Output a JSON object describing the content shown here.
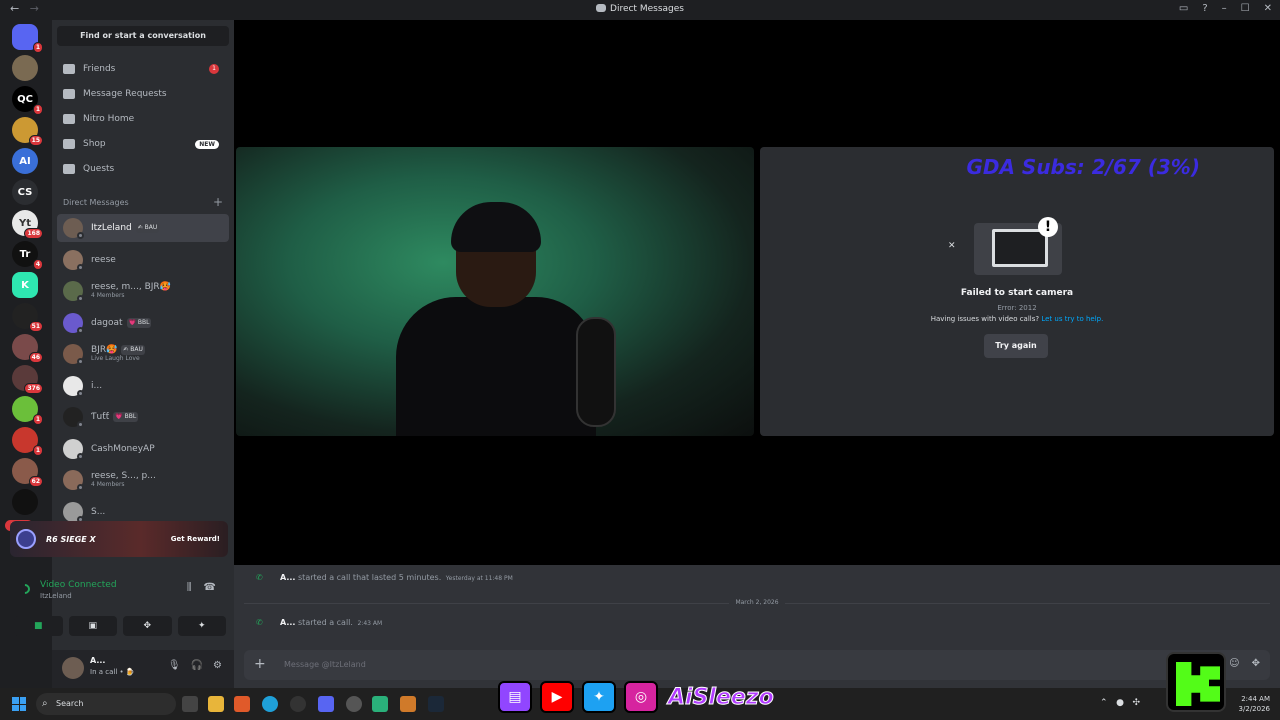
{
  "titlebar": {
    "title": "Direct Messages",
    "back": "←",
    "forward": "→",
    "win_icons": [
      "▭",
      "?",
      "–",
      "☐",
      "✕"
    ]
  },
  "guilds": {
    "items": [
      {
        "name": "discord-home",
        "label": "",
        "badge": "1",
        "color": "#5865f2"
      },
      {
        "name": "server-avatar-1",
        "label": "",
        "badge": "",
        "color": "#7a6a52"
      },
      {
        "name": "server-qc",
        "label": "QC",
        "badge": "1",
        "color": "#000000"
      },
      {
        "name": "server-4",
        "label": "",
        "badge": "15",
        "color": "#c93"
      },
      {
        "name": "server-ai",
        "label": "AI",
        "badge": "",
        "color": "#3a6fd8"
      },
      {
        "name": "server-cs",
        "label": "CS",
        "badge": "",
        "color": "#2b2d31"
      },
      {
        "name": "server-yt",
        "label": "Yt",
        "badge": "168",
        "color": "#e8e8e8"
      },
      {
        "name": "server-tr",
        "label": "Tr",
        "badge": "4",
        "color": "#111"
      },
      {
        "name": "server-kick",
        "label": "K",
        "badge": "",
        "color": "#2ee6b0"
      },
      {
        "name": "server-10",
        "label": "",
        "badge": "51",
        "color": "#222"
      },
      {
        "name": "server-11",
        "label": "",
        "badge": "46",
        "color": "#7a4a4a"
      },
      {
        "name": "server-12",
        "label": "",
        "badge": "376",
        "color": "#5a3a3a"
      },
      {
        "name": "server-13",
        "label": "",
        "badge": "1",
        "color": "#6bbf3a"
      },
      {
        "name": "server-14",
        "label": "",
        "badge": "1",
        "color": "#c8372d"
      },
      {
        "name": "server-15",
        "label": "",
        "badge": "62",
        "color": "#8a5a4a"
      },
      {
        "name": "server-kick2",
        "label": "",
        "badge": "",
        "color": "#111"
      }
    ],
    "new_label": "NEW"
  },
  "sidebar": {
    "find": "Find or start a conversation",
    "nav": [
      {
        "name": "friends",
        "label": "Friends",
        "badge": "1"
      },
      {
        "name": "message-requests",
        "label": "Message Requests",
        "badge": ""
      },
      {
        "name": "nitro-home",
        "label": "Nitro Home",
        "badge": ""
      },
      {
        "name": "shop",
        "label": "Shop",
        "badge": "NEW"
      },
      {
        "name": "quests",
        "label": "Quests",
        "badge": ""
      }
    ],
    "dm_header": "Direct Messages",
    "dms": [
      {
        "name": "ItzLeland",
        "tag": "✍ BAU",
        "sub": "",
        "color": "#6d5d52",
        "active": true
      },
      {
        "name": "reese",
        "tag": "",
        "sub": "",
        "color": "#8a7060",
        "active": false
      },
      {
        "name": "reese, m..., BJR🥵",
        "tag": "",
        "sub": "4 Members",
        "color": "#5a6a4a",
        "active": false
      },
      {
        "name": "dagoat",
        "tag": "💗 BBL",
        "sub": "",
        "color": "#6a5acd",
        "active": false
      },
      {
        "name": "BJR🥵",
        "tag": "✍ BAU",
        "sub": "Live Laugh Love",
        "color": "#7a5a4a",
        "active": false
      },
      {
        "name": "i...",
        "tag": "",
        "sub": "",
        "color": "#e8e8e8",
        "active": false
      },
      {
        "name": "Ƭuƭƭ",
        "tag": "💗 BBL",
        "sub": "",
        "color": "#222",
        "active": false
      },
      {
        "name": "CashMoneyAP",
        "tag": "",
        "sub": "",
        "color": "#d0d0d0",
        "active": false
      },
      {
        "name": "reese, S..., p...",
        "tag": "",
        "sub": "4 Members",
        "color": "#8a6a5a",
        "active": false
      },
      {
        "name": "S...",
        "tag": "",
        "sub": "",
        "color": "#9a9a9a",
        "active": false
      }
    ],
    "promo": {
      "title": "R6 SIEGE X",
      "button": "Get Reward!"
    },
    "voice": {
      "status": "Video Connected",
      "channel": "ItzLeland"
    },
    "user": {
      "name": "A...",
      "status": "In a call • 🍺"
    }
  },
  "call": {
    "overlay": "GDA Subs: 2/67 (3%)",
    "error_title": "Failed to start camera",
    "error_code": "Error: 2012",
    "help_text": "Having issues with video calls?",
    "help_link": "Let us try to help.",
    "retry": "Try again"
  },
  "messages": [
    {
      "author": "A...",
      "text": "started a call that lasted 5 minutes.",
      "time": "Yesterday at 11:48 PM"
    },
    {
      "author": "A...",
      "text": "started a call.",
      "time": "2:43 AM"
    }
  ],
  "date_divider": "March 2, 2026",
  "composer": {
    "placeholder": "Message @ItzLeland"
  },
  "taskbar": {
    "search": "Search",
    "time": "2:44 AM",
    "date": "3/2/2026",
    "handle": "AiSleezo"
  }
}
